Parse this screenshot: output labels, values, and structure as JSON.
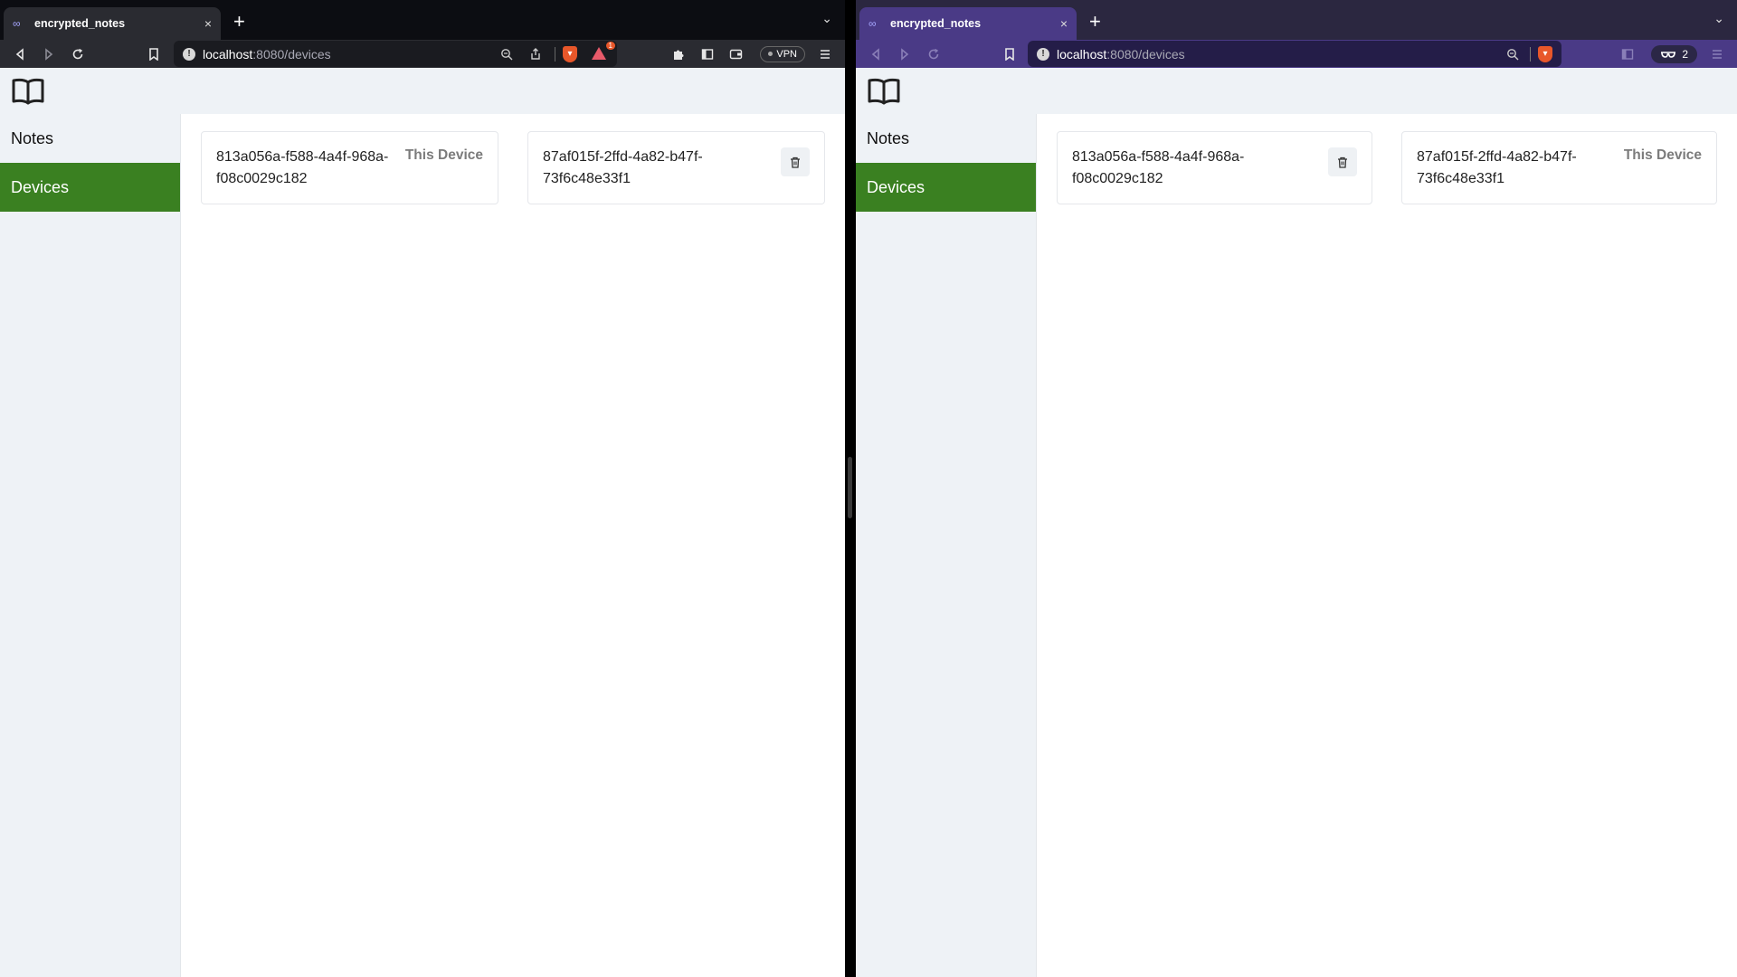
{
  "left": {
    "tab": {
      "title": "encrypted_notes",
      "favicon": "∞",
      "close": "×"
    },
    "newtab": "+",
    "tabmenu": "⌄",
    "url": {
      "host": "localhost",
      "path": ":8080/devices"
    },
    "rewards_badge": "1",
    "vpn_label": "VPN",
    "nav": {
      "notes": "Notes",
      "devices": "Devices"
    },
    "devices": [
      {
        "id": "813a056a-f588-4a4f-968a-f08c0029c182",
        "tag": "This Device"
      },
      {
        "id": "87af015f-2ffd-4a82-b47f-73f6c48e33f1",
        "tag": ""
      }
    ]
  },
  "right": {
    "tab": {
      "title": "encrypted_notes",
      "favicon": "∞",
      "close": "×"
    },
    "newtab": "+",
    "tabmenu": "⌄",
    "url": {
      "host": "localhost",
      "path": ":8080/devices"
    },
    "private_count": "2",
    "nav": {
      "notes": "Notes",
      "devices": "Devices"
    },
    "devices": [
      {
        "id": "813a056a-f588-4a4f-968a-f08c0029c182",
        "tag": ""
      },
      {
        "id": "87af015f-2ffd-4a82-b47f-73f6c48e33f1",
        "tag": "This Device"
      }
    ]
  },
  "colors": {
    "accent": "#3a8021",
    "sidebar_bg": "#eef2f6",
    "brave_orange": "#e8572a"
  }
}
